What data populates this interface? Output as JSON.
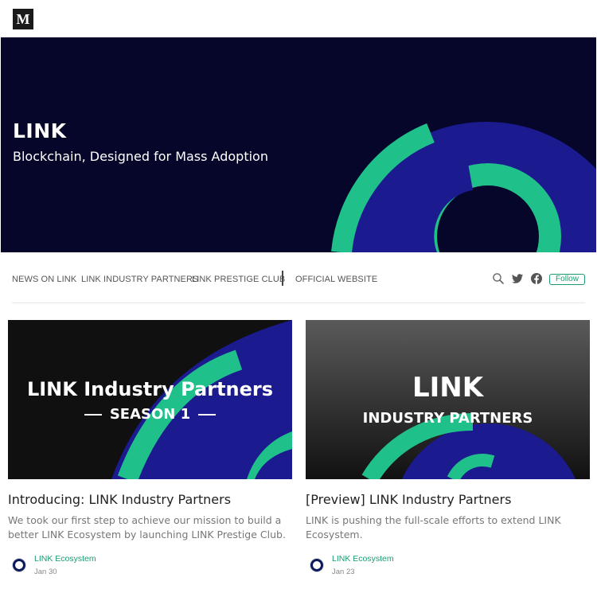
{
  "site": {
    "logo_letter": "M"
  },
  "hero": {
    "title": "LINK",
    "subtitle": "Blockchain, Designed for Mass Adoption"
  },
  "nav": {
    "items": [
      "NEWS ON LINK",
      "LINK INDUSTRY PARTNERS",
      "LINK PRESTIGE CLUB",
      "OFFICIAL WEBSITE"
    ],
    "follow_label": "Follow",
    "icons": [
      "search-icon",
      "twitter-icon",
      "facebook-icon"
    ]
  },
  "colors": {
    "hero_bg": "#05062a",
    "accent_green": "#20c08a",
    "accent_blue": "#1b1a8f",
    "follow_green": "#1c9b72"
  },
  "posts": [
    {
      "image_title": "LINK Industry Partners",
      "image_subtitle": "SEASON 1",
      "title": "Introducing: LINK Industry Partners",
      "description": "We took our first step to achieve our mission to build a better LINK Ecosystem by launching LINK Prestige Club.",
      "author": "LINK Ecosystem",
      "date": "Jan 30"
    },
    {
      "image_title": "LINK",
      "image_subtitle": "INDUSTRY PARTNERS",
      "title": "[Preview] LINK Industry Partners",
      "description": "LINK is pushing the full-scale efforts to extend LINK Ecosystem.",
      "author": "LINK Ecosystem",
      "date": "Jan 23"
    }
  ]
}
